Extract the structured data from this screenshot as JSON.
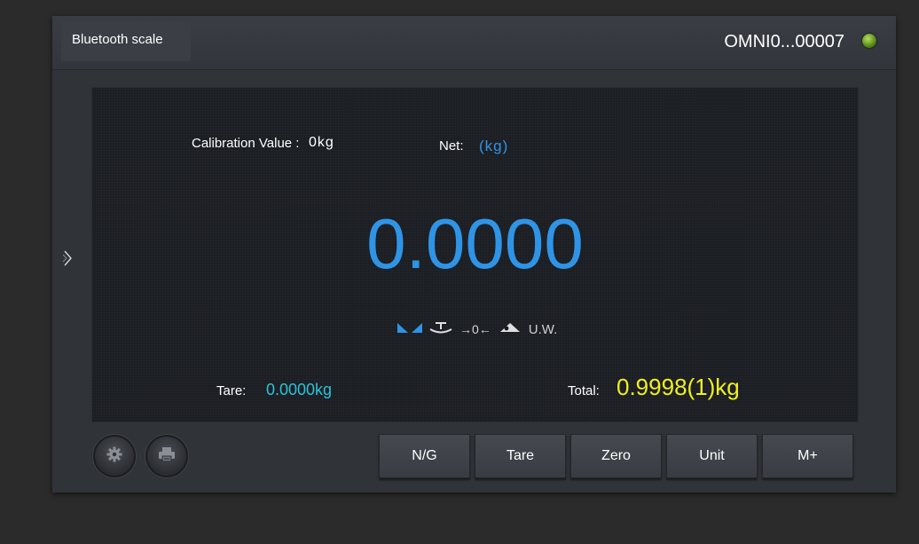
{
  "header": {
    "title": "Bluetooth scale",
    "device_name": "OMNI0...00007",
    "status_led_color": "#6aa91c"
  },
  "nav": {
    "expand_icon": "chevron-right-icon"
  },
  "display": {
    "calibration_label": "Calibration Value :",
    "calibration_value": "0kg",
    "net_label": "Net:",
    "net_unit": "(kg)",
    "reading": "0.0000",
    "indicators": {
      "stable_icon": "stable-icon",
      "tare_icon": "tare-icon",
      "zero_text": "→0←",
      "weigh_icon": "weighing-icon",
      "uw_text": "U.W."
    },
    "tare_label": "Tare:",
    "tare_value": "0.0000kg",
    "total_label": "Total:",
    "total_value": "0.9998(1)kg",
    "colors": {
      "reading": "#2f94e6",
      "tare_value": "#29c4d8",
      "total_value": "#f0f01e"
    }
  },
  "toolbar": {
    "settings_icon": "gear-icon",
    "print_icon": "printer-icon",
    "ng_label": "N/G",
    "tare_label": "Tare",
    "zero_label": "Zero",
    "unit_label": "Unit",
    "mplus_label": "M+"
  }
}
